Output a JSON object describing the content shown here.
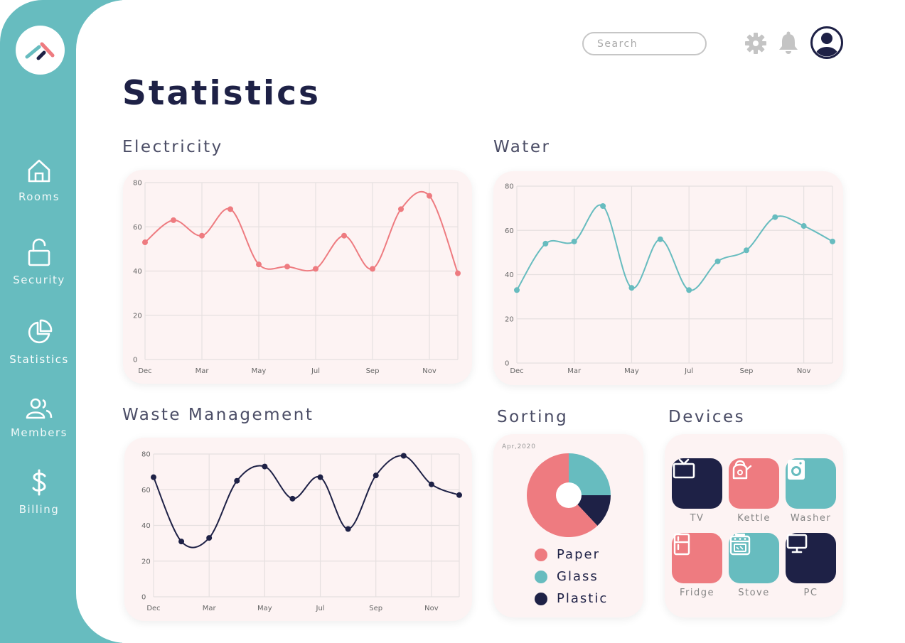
{
  "colors": {
    "teal": "#67bcbf",
    "coral": "#ee7b80",
    "navy": "#1e2146",
    "card_bg": "#fdf3f3"
  },
  "sidebar": {
    "logo_icon": "app-logo",
    "items": [
      {
        "label": "Rooms",
        "icon": "home-icon"
      },
      {
        "label": "Security",
        "icon": "unlock-icon"
      },
      {
        "label": "Statistics",
        "icon": "pie-chart-icon",
        "active": true
      },
      {
        "label": "Members",
        "icon": "members-icon"
      },
      {
        "label": "Billing",
        "icon": "dollar-icon"
      }
    ]
  },
  "header": {
    "search_placeholder": "Search",
    "icons": [
      "gear-icon",
      "bell-icon",
      "user-avatar-icon"
    ]
  },
  "page": {
    "title": "Statistics"
  },
  "sections": {
    "electricity": "Electricity",
    "water": "Water",
    "waste": "Waste Management",
    "sorting": "Sorting",
    "devices": "Devices"
  },
  "chart_data": [
    {
      "type": "line",
      "id": "electricity",
      "title": "Electricity",
      "x_ticks": [
        "Dec",
        "Mar",
        "May",
        "Jul",
        "Sep",
        "Nov"
      ],
      "y_ticks": [
        0,
        20,
        40,
        60,
        80
      ],
      "ylim": [
        0,
        80
      ],
      "color": "#ee7b80",
      "values": [
        53,
        63,
        56,
        68,
        43,
        42,
        41,
        56,
        41,
        68,
        74,
        39
      ]
    },
    {
      "type": "line",
      "id": "water",
      "title": "Water",
      "x_ticks": [
        "Dec",
        "Mar",
        "May",
        "Jul",
        "Sep",
        "Nov"
      ],
      "y_ticks": [
        0,
        20,
        40,
        60,
        80
      ],
      "ylim": [
        0,
        80
      ],
      "color": "#67bcbf",
      "values": [
        33,
        54,
        55,
        71,
        34,
        56,
        33,
        46,
        51,
        66,
        62,
        55
      ]
    },
    {
      "type": "line",
      "id": "waste",
      "title": "Waste Management",
      "x_ticks": [
        "Dec",
        "Mar",
        "May",
        "Jul",
        "Sep",
        "Nov"
      ],
      "y_ticks": [
        0,
        20,
        40,
        60,
        80
      ],
      "ylim": [
        0,
        80
      ],
      "color": "#1e2146",
      "values": [
        67,
        31,
        33,
        65,
        73,
        55,
        67,
        38,
        68,
        79,
        63,
        57
      ]
    },
    {
      "type": "pie",
      "id": "sorting",
      "title": "Sorting",
      "date": "Apr,2020",
      "slices": [
        {
          "label": "Paper",
          "value": 62,
          "color": "#ee7b80"
        },
        {
          "label": "Glass",
          "value": 25,
          "color": "#67bcbf"
        },
        {
          "label": "Plastic",
          "value": 13,
          "color": "#1e2146"
        }
      ]
    }
  ],
  "devices": [
    {
      "label": "TV",
      "icon": "tv-icon",
      "color": "#1e2146"
    },
    {
      "label": "Kettle",
      "icon": "kettle-icon",
      "color": "#ee7b80"
    },
    {
      "label": "Washer",
      "icon": "washer-icon",
      "color": "#67bcbf"
    },
    {
      "label": "Fridge",
      "icon": "fridge-icon",
      "color": "#ee7b80"
    },
    {
      "label": "Stove",
      "icon": "stove-icon",
      "color": "#67bcbf"
    },
    {
      "label": "PC",
      "icon": "monitor-icon",
      "color": "#1e2146"
    }
  ]
}
